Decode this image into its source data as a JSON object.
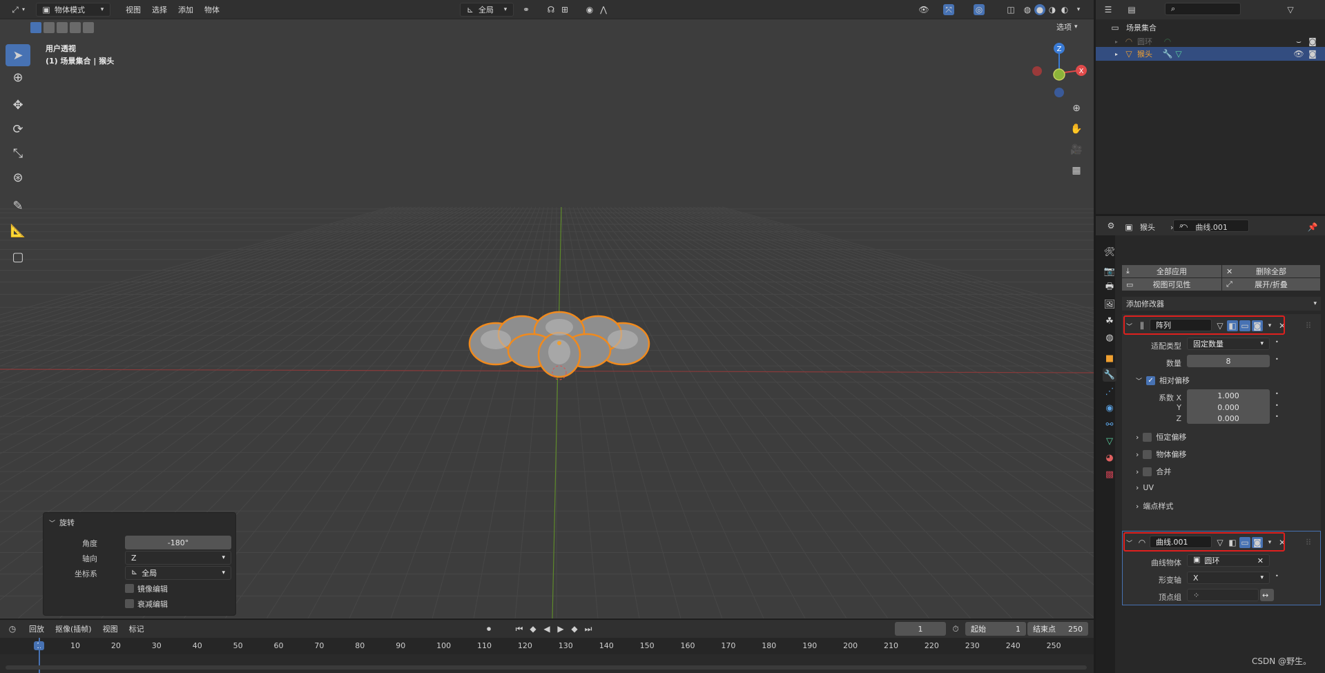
{
  "header": {
    "mode": "物体模式",
    "menus": [
      "视图",
      "选择",
      "添加",
      "物体"
    ],
    "transform_orientation": "全局",
    "options": "选项"
  },
  "overlay_text": {
    "view_name": "用户透视",
    "collection_info": "(1) 场景集合 | 猴头"
  },
  "gizmo": {
    "z": "Z",
    "x": "X"
  },
  "operator_panel": {
    "title": "旋转",
    "angle_label": "角度",
    "angle_value": "-180°",
    "axis_label": "轴向",
    "axis_value": "Z",
    "orient_label": "坐标系",
    "orient_value": "全局",
    "mirror_label": "镜像编辑",
    "falloff_label": "衰减编辑"
  },
  "timeline": {
    "menus": [
      "回放",
      "抠像(插帧)",
      "视图",
      "标记"
    ],
    "current_frame": "1",
    "start_label": "起始",
    "start_value": "1",
    "end_label": "结束点",
    "end_value": "250",
    "ticks": [
      "1",
      "10",
      "20",
      "30",
      "40",
      "50",
      "60",
      "70",
      "80",
      "90",
      "100",
      "110",
      "120",
      "130",
      "140",
      "150",
      "160",
      "170",
      "180",
      "190",
      "200",
      "210",
      "220",
      "230",
      "240",
      "250"
    ]
  },
  "outliner": {
    "root": "场景集合",
    "items": [
      {
        "name": "圆环"
      },
      {
        "name": "猴头"
      }
    ]
  },
  "properties": {
    "breadcrumb_object": "猴头",
    "breadcrumb_modifier": "曲线.001",
    "apply_all": "全部应用",
    "delete_all": "删除全部",
    "viewport_vis": "视图可见性",
    "expand_collapse": "展开/折叠",
    "add_modifier": "添加修改器",
    "array": {
      "name": "阵列",
      "fit_type_label": "适配类型",
      "fit_type_value": "固定数量",
      "count_label": "数量",
      "count_value": "8",
      "relative_offset": "相对偏移",
      "factor_x_label": "系数 X",
      "factor_x": "1.000",
      "y_label": "Y",
      "factor_y": "0.000",
      "z_label": "Z",
      "factor_z": "0.000",
      "const_offset": "恒定偏移",
      "obj_offset": "物体偏移",
      "merge": "合并",
      "uv": "UV",
      "caps": "端点样式"
    },
    "curve": {
      "name": "曲线.001",
      "curve_obj_label": "曲线物体",
      "curve_obj_value": "圆环",
      "deform_axis_label": "形变轴",
      "deform_axis_value": "X",
      "vgroup_label": "顶点组"
    }
  },
  "watermark": "CSDN @野生。"
}
